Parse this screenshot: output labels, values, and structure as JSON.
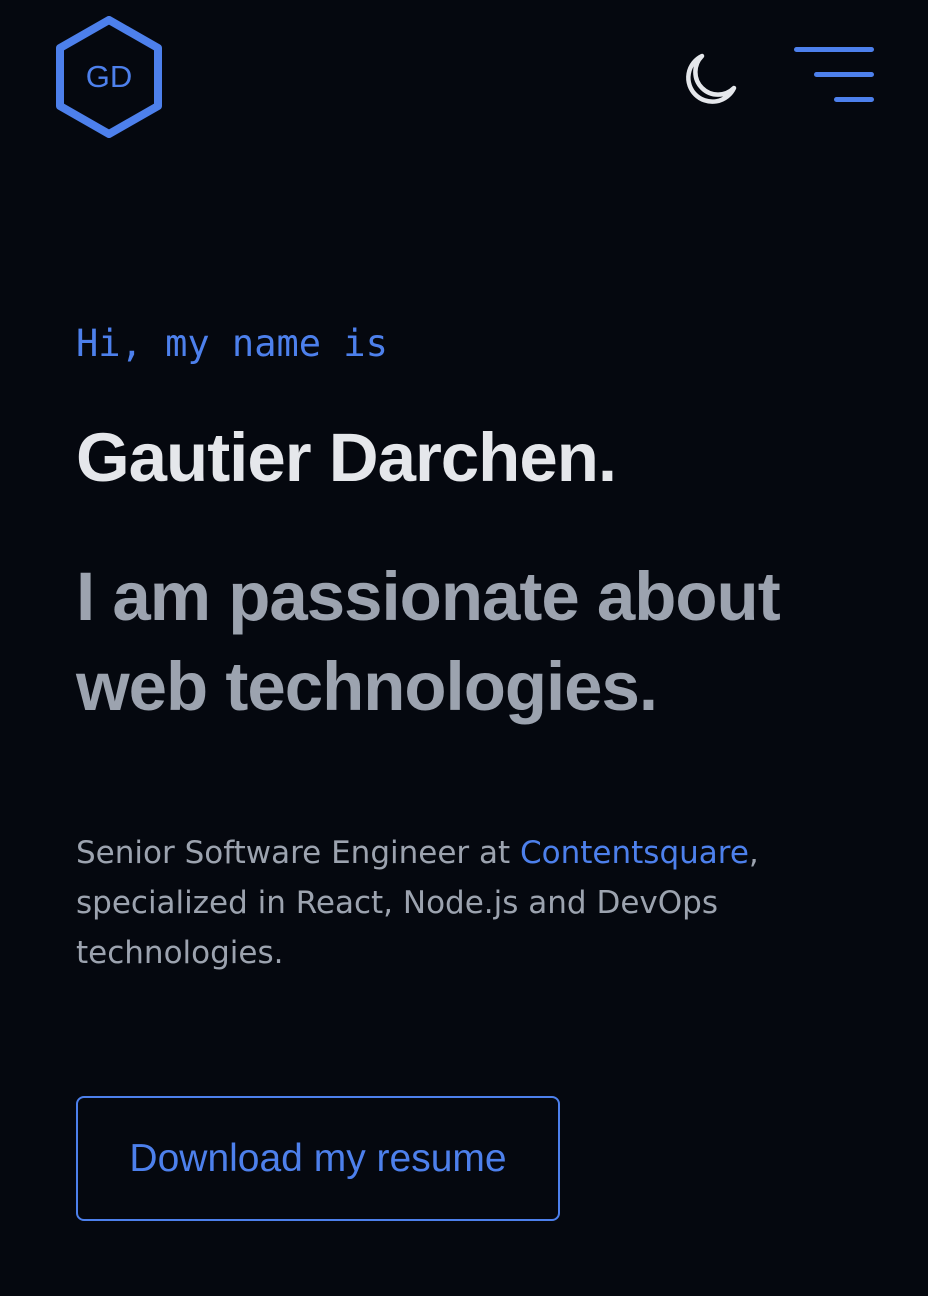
{
  "header": {
    "logo_text": "GD",
    "logo_icon": "hexagon-logo-icon",
    "theme_toggle_icon": "moon-icon",
    "menu_icon": "hamburger-menu-icon"
  },
  "hero": {
    "greeting": "Hi, my name is",
    "name": "Gautier Darchen.",
    "tagline": "I am passionate about web technologies.",
    "description": {
      "before_link": "Senior Software Engineer at ",
      "link_text": "Contentsquare",
      "after_link": ", specialized in React, Node.js and DevOps technologies."
    },
    "resume_button_label": "Download my resume"
  },
  "colors": {
    "background": "#05080f",
    "accent": "#4d80ec",
    "heading": "#e5e7eb",
    "muted": "#9ca3af"
  }
}
